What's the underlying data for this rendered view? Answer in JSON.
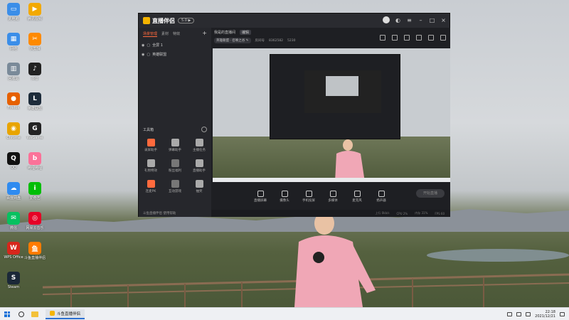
{
  "desktop": {
    "icons": [
      {
        "label": "此电脑",
        "color": "#3b8ee8",
        "glyph": "▭"
      },
      {
        "label": "网络",
        "color": "#3b8ee8",
        "glyph": "▦"
      },
      {
        "label": "回收站",
        "color": "#7a8a99",
        "glyph": "▥"
      },
      {
        "label": "Firefox",
        "color": "#e66000",
        "glyph": "●"
      },
      {
        "label": "Chrome",
        "color": "#e8a400",
        "glyph": "◉"
      },
      {
        "label": "QQ",
        "color": "#111111",
        "glyph": "Q"
      },
      {
        "label": "百度网盘",
        "color": "#2f8bf0",
        "glyph": "☁"
      },
      {
        "label": "微信",
        "color": "#07c160",
        "glyph": "✉"
      },
      {
        "label": "WPS Office",
        "color": "#d7261c",
        "glyph": "W"
      },
      {
        "label": "Steam",
        "color": "#1b2838",
        "glyph": "S"
      },
      {
        "label": "腾讯视频",
        "color": "#f2a900",
        "glyph": "▶"
      },
      {
        "label": "快剪辑",
        "color": "#ff8a00",
        "glyph": "✂"
      },
      {
        "label": "抖音",
        "color": "#222222",
        "glyph": "♪"
      },
      {
        "label": "英雄联盟",
        "color": "#1d2b3a",
        "glyph": "L"
      },
      {
        "label": "WeGame",
        "color": "#222222",
        "glyph": "G"
      },
      {
        "label": "哔哩哔哩",
        "color": "#fb7299",
        "glyph": "b"
      },
      {
        "label": "爱奇艺",
        "color": "#00be06",
        "glyph": "i"
      },
      {
        "label": "网易云音乐",
        "color": "#e60026",
        "glyph": "◎"
      },
      {
        "label": "斗鱼直播伴侣",
        "color": "#ff7b00",
        "glyph": "鱼"
      }
    ]
  },
  "app": {
    "name": "直播伴侣",
    "version": "5.0 ▶",
    "left_tabs": [
      "场景管理",
      "素材",
      "特效"
    ],
    "scene_items": [
      "全屏 1",
      "英雄联盟"
    ],
    "tools_header": "工具箱",
    "tools": [
      {
        "label": "录屏助手",
        "color": "#ff6a3d"
      },
      {
        "label": "弹幕助手",
        "color": "#aaaaaa"
      },
      {
        "label": "主播任务",
        "color": "#aaaaaa"
      },
      {
        "label": "礼物特效",
        "color": "#aaaaaa"
      },
      {
        "label": "粉丝福利",
        "color": "#777777"
      },
      {
        "label": "直播助手",
        "color": "#aaaaaa"
      },
      {
        "label": "连麦PK",
        "color": "#ff6a3d"
      },
      {
        "label": "互动游戏",
        "color": "#777777"
      },
      {
        "label": "抽奖",
        "color": "#aaaaaa"
      }
    ],
    "center_title": "我是的直播间",
    "center_tag": "编辑",
    "info": {
      "category": "英雄联盟 · 召唤之谷 ✎",
      "room_label": "房间号",
      "room_number": "8362582",
      "viewers": "5230"
    },
    "controls": [
      "直播屏幕",
      "摄像头",
      "手机投屏",
      "多媒体",
      "麦克风",
      "扬声器"
    ],
    "start_button": "开始直播",
    "status_items": [
      "上行 0kb/s",
      "CPU 2%",
      "内存 31%",
      "FPS 60"
    ],
    "footer": "斗鱼直播伴侣 使用帮助"
  },
  "taskbar": {
    "app_label": "斗鱼直播伴侣",
    "time": "22:18",
    "date": "2021/12/21"
  }
}
